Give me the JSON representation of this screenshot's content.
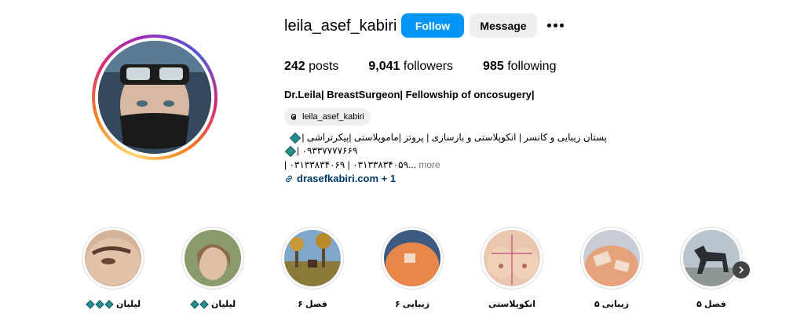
{
  "profile": {
    "username": "leila_asef_kabiri",
    "follow_label": "Follow",
    "message_label": "Message",
    "more_icon": "ellipsis-icon"
  },
  "stats": {
    "posts_count": "242",
    "posts_label": "posts",
    "followers_count": "9,041",
    "followers_label": "followers",
    "following_count": "985",
    "following_label": "following"
  },
  "bio": {
    "name_line": "Dr.Leila| BreastSurgeon| Fellowship of oncosugery|",
    "threads_handle": "leila_asef_kabiri",
    "line1": "پستان زیبایی و کانسر | انکوپلاستی و بازسازی | پروتز |ماموپلاستی |پیکرتراشی |",
    "line2": "| ۰۹۳۳۷۷۷۷۶۶۹",
    "line3": "| ۰۳۱۳۳۸۳۴۰۶۹ | ۰۳۱۳۳۸۳۴۰۵۹...",
    "more_label": "more",
    "website": "drasefkabiri.com + 1"
  },
  "highlights": [
    {
      "label": "لیلیان",
      "diamonds": 3
    },
    {
      "label": "لیلیان",
      "diamonds": 2
    },
    {
      "label": "فصل ۶",
      "diamonds": 0
    },
    {
      "label": "زیبایی ۶",
      "diamonds": 0
    },
    {
      "label": "انکوپلاستی",
      "diamonds": 0
    },
    {
      "label": "زیبایی ۵",
      "diamonds": 0
    },
    {
      "label": "فصل ۵",
      "diamonds": 0
    }
  ],
  "colors": {
    "follow_button": "#0095f6",
    "link": "#00376b",
    "diamond": "#2b8c8c"
  }
}
